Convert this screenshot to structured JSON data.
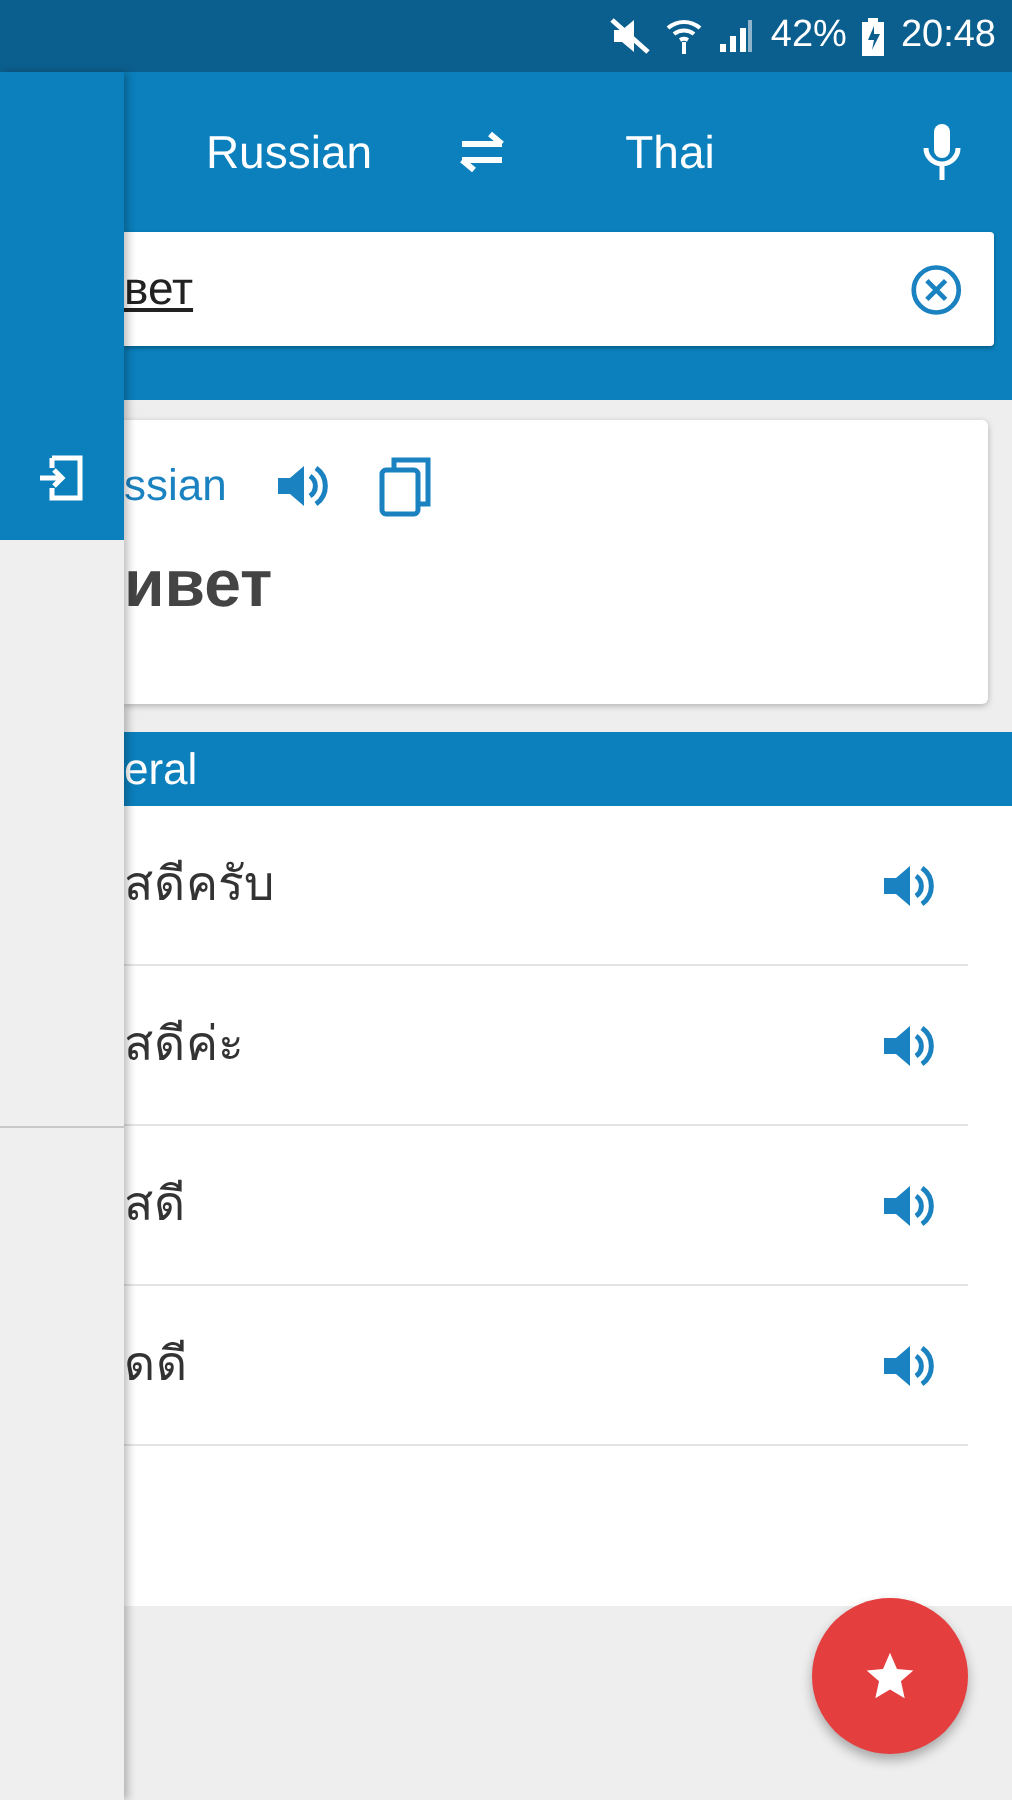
{
  "status_bar": {
    "battery": "42%",
    "time": "20:48"
  },
  "toolbar": {
    "source_language": "Russian",
    "target_language": "Thai"
  },
  "search": {
    "value": "вет"
  },
  "result": {
    "language": "ssian",
    "text": "ивет"
  },
  "section": {
    "title": "eral"
  },
  "translations": [
    {
      "text": "สดีครับ"
    },
    {
      "text": "สดีค่ะ"
    },
    {
      "text": "สดี"
    },
    {
      "text": "ดดี"
    }
  ]
}
